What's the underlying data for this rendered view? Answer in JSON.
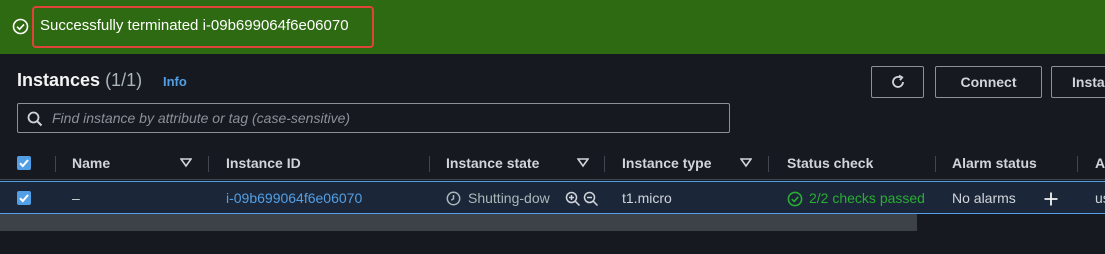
{
  "banner": {
    "message": "Successfully terminated i-09b699064f6e06070",
    "icon": "check-circle-icon",
    "color": "#2e6a12"
  },
  "header": {
    "title": "Instances",
    "count": "(1/1)",
    "info": "Info"
  },
  "toolbar": {
    "refresh_icon": "refresh-icon",
    "connect_label": "Connect",
    "actions_label": "Insta"
  },
  "search": {
    "placeholder": "Find instance by attribute or tag (case-sensitive)",
    "value": ""
  },
  "table": {
    "columns": [
      "Name",
      "Instance ID",
      "Instance state",
      "Instance type",
      "Status check",
      "Alarm status",
      "A"
    ],
    "rows": [
      {
        "selected": true,
        "name": "–",
        "instance_id": "i-09b699064f6e06070",
        "instance_state": "Shutting-dow",
        "instance_type": "t1.micro",
        "status_check": "2/2 checks passed",
        "alarm_status": "No alarms",
        "last": "us"
      }
    ]
  },
  "colors": {
    "accent": "#539fe5",
    "success": "#29ad32",
    "highlight": "#e0433a"
  }
}
